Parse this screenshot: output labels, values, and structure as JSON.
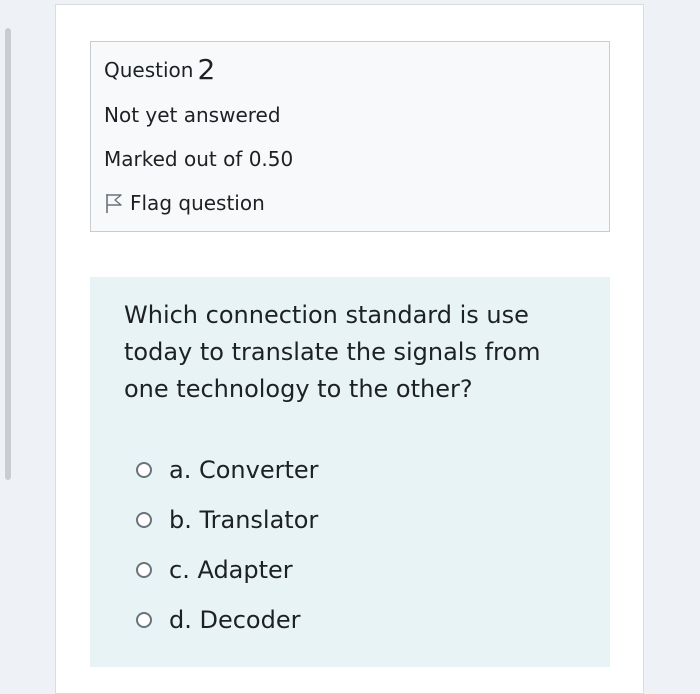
{
  "question_info": {
    "label": "Question",
    "number": "2",
    "status": "Not yet answered",
    "marks": "Marked out of 0.50",
    "flag_label": "Flag question",
    "flag_icon": "flag-icon"
  },
  "question": {
    "text": "Which connection standard is use today to translate the signals from one technology to the other?",
    "answers": [
      {
        "label": "a. Converter"
      },
      {
        "label": "b. Translator"
      },
      {
        "label": "c. Adapter"
      },
      {
        "label": "d. Decoder"
      }
    ]
  },
  "colors": {
    "page_background": "#eef2f6",
    "info_background": "#f8f9fa",
    "question_background": "#e7f3f5",
    "text": "#1d2125"
  }
}
